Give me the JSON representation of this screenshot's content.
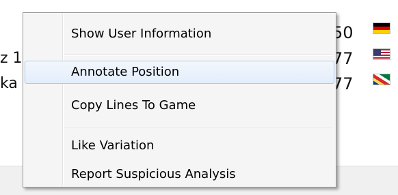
{
  "background_rows": [
    {
      "left_text": "",
      "number": "50",
      "flag": "germany-flag"
    },
    {
      "left_text": "z 1",
      "number": "77",
      "flag": "usa-flag"
    },
    {
      "left_text": "ka",
      "number": "77",
      "flag": "seychelles-flag"
    }
  ],
  "menu": {
    "items": [
      {
        "label": "Show User Information"
      },
      {
        "label": "Annotate Position",
        "highlighted": true
      },
      {
        "label": "Copy Lines To Game"
      },
      {
        "label": "Like Variation"
      },
      {
        "label": "Report Suspicious Analysis"
      }
    ]
  },
  "colors": {
    "menu_bg": "#f5f5f5",
    "menu_border": "#979797",
    "highlight_border": "#a9c8f3",
    "highlight_bg": "#e3edfb"
  }
}
